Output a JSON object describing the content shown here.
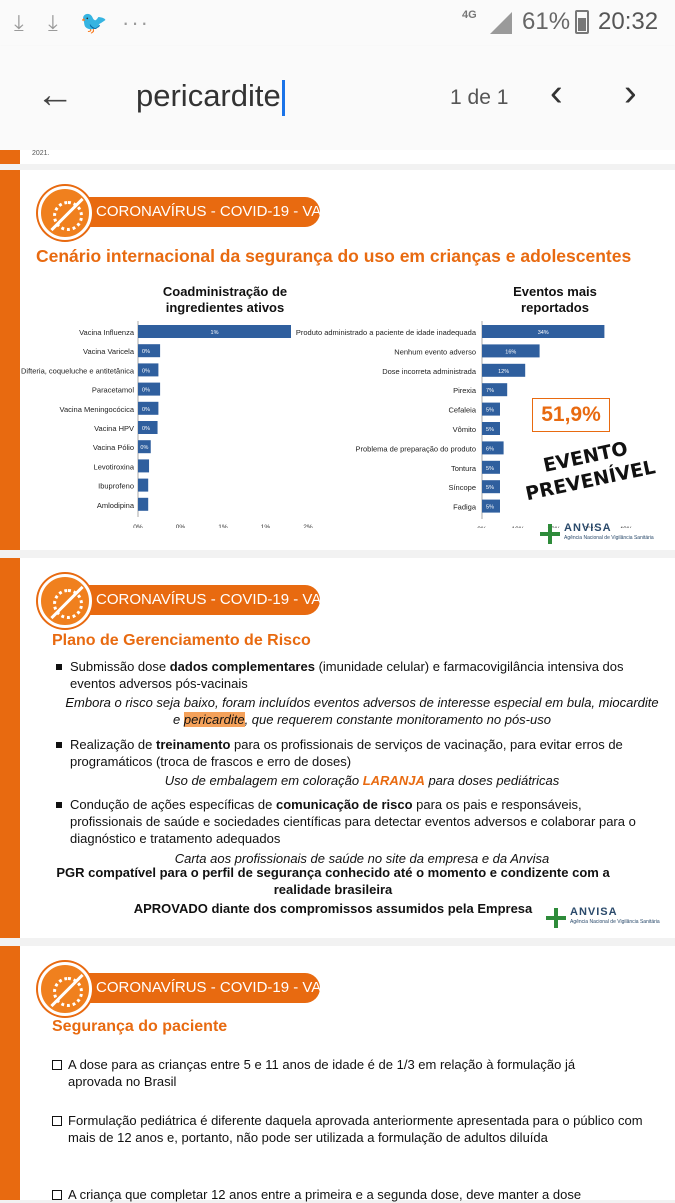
{
  "status_bar": {
    "network": "4G",
    "battery": "61%",
    "time": "20:32",
    "icons": [
      "download-icon",
      "download-icon",
      "twitter-icon",
      "more-icon"
    ]
  },
  "find_bar": {
    "query": "pericardite",
    "match_count": "1 de 1"
  },
  "top_fragment": {
    "text": "2021."
  },
  "slide1": {
    "banner": "CORONAVÍRUS - COVID-19 - VAC",
    "title": "Cenário internacional da segurança do uso em crianças e adolescentes",
    "chart_left_title": "Coadministração de ingredientes ativos",
    "chart_right_title": "Eventos mais reportados",
    "highlight": "51,9%",
    "evento_line1": "EVENTO",
    "evento_line2": "PREVENÍVEL",
    "anvisa_name": "ANVISA",
    "anvisa_sub": "Agência Nacional de Vigilância Sanitária"
  },
  "chart_data": [
    {
      "type": "bar",
      "orientation": "horizontal",
      "title": "Coadministração de ingredientes ativos",
      "categories": [
        "Vacina Influenza",
        "Vacina Varicela",
        "Difteria, coqueluche e antitetânica",
        "Paracetamol",
        "Vacina Meningocócica",
        "Vacina HPV",
        "Vacina Pólio",
        "Levotiroxina",
        "Ibuprofeno",
        "Amlodipina"
      ],
      "values": [
        1.8,
        0.26,
        0.24,
        0.26,
        0.24,
        0.23,
        0.15,
        0.13,
        0.12,
        0.12
      ],
      "data_labels": [
        "1%",
        "0%",
        "0%",
        "0%",
        "0%",
        "0%",
        "0%",
        "",
        "",
        ""
      ],
      "x_ticks": [
        "0%",
        "0%",
        "1%",
        "1%",
        "2%"
      ],
      "xlim": [
        0,
        2
      ]
    },
    {
      "type": "bar",
      "orientation": "horizontal",
      "title": "Eventos mais reportados",
      "categories": [
        "Produto administrado a paciente de idade inadequada",
        "Nenhum evento adverso",
        "Dose incorreta administrada",
        "Pirexia",
        "Cefaleia",
        "Vômito",
        "Problema de preparação do produto",
        "Tontura",
        "Síncope",
        "Fadiga"
      ],
      "values": [
        34,
        16,
        12,
        7,
        5,
        5,
        6,
        5,
        5,
        5
      ],
      "data_labels": [
        "34%",
        "16%",
        "12%",
        "7%",
        "5%",
        "5%",
        "6%",
        "5%",
        "5%",
        "5%"
      ],
      "x_ticks": [
        "0%",
        "10%",
        "20%",
        "30%",
        "40%"
      ],
      "xlim": [
        0,
        40
      ]
    }
  ],
  "slide2": {
    "banner": "CORONAVÍRUS - COVID-19 - VAC",
    "title": "Plano de Gerenciamento de Risco",
    "b1_pre": "Submissão dose ",
    "b1_bold": "dados complementares",
    "b1_post": " (imunidade celular) e farmacovigilância intensiva dos eventos adversos pós-vacinais",
    "b1_ital_pre": "Embora o risco seja baixo, foram incluídos eventos adversos de interesse especial em bula, miocardite e ",
    "b1_ital_hl": "pericardite",
    "b1_ital_post": ", que requerem constante monitoramento no pós-uso",
    "b2_pre": "Realização de ",
    "b2_bold": "treinamento",
    "b2_post": " para os profissionais de serviços de vacinação, para evitar erros de programáticos (troca de frascos e erro de doses)",
    "b2_ital_pre": "Uso de embalagem em coloração ",
    "b2_ital_orange": "LARANJA",
    "b2_ital_post": " para doses pediátricas",
    "b3_pre": "Condução de ações específicas de ",
    "b3_bold": "comunicação de risco",
    "b3_post": " para os pais e responsáveis, profissionais de saúde e sociedades científicas para detectar eventos adversos e colaborar para o diagnóstico e tratamento adequados",
    "b3_ital": "Carta aos profissionais de saúde no site da empresa e da Anvisa",
    "conclusion1": "PGR compatível para o perfil de segurança conhecido até o momento e condizente com a realidade brasileira",
    "conclusion2": "APROVADO diante dos compromissos assumidos pela Empresa",
    "anvisa_name": "ANVISA",
    "anvisa_sub": "Agência Nacional de Vigilância Sanitária"
  },
  "slide3": {
    "banner": "CORONAVÍRUS - COVID-19 - VAC",
    "title": "Segurança do paciente",
    "items": [
      "A dose para as crianças entre 5 e 11 anos de idade é de 1/3 em relação à formulação já aprovada no Brasil",
      "Formulação pediátrica é diferente daquela aprovada anteriormente apresentada para o público com mais de 12 anos e, portanto, não pode ser utilizada a formulação de adultos diluída",
      "A criança que completar 12 anos entre a primeira e a segunda dose, deve manter a dose"
    ]
  },
  "colors": {
    "accent": "#e86a10",
    "bar": "#2f5f9e",
    "anvisa_green": "#2e8b3a"
  }
}
